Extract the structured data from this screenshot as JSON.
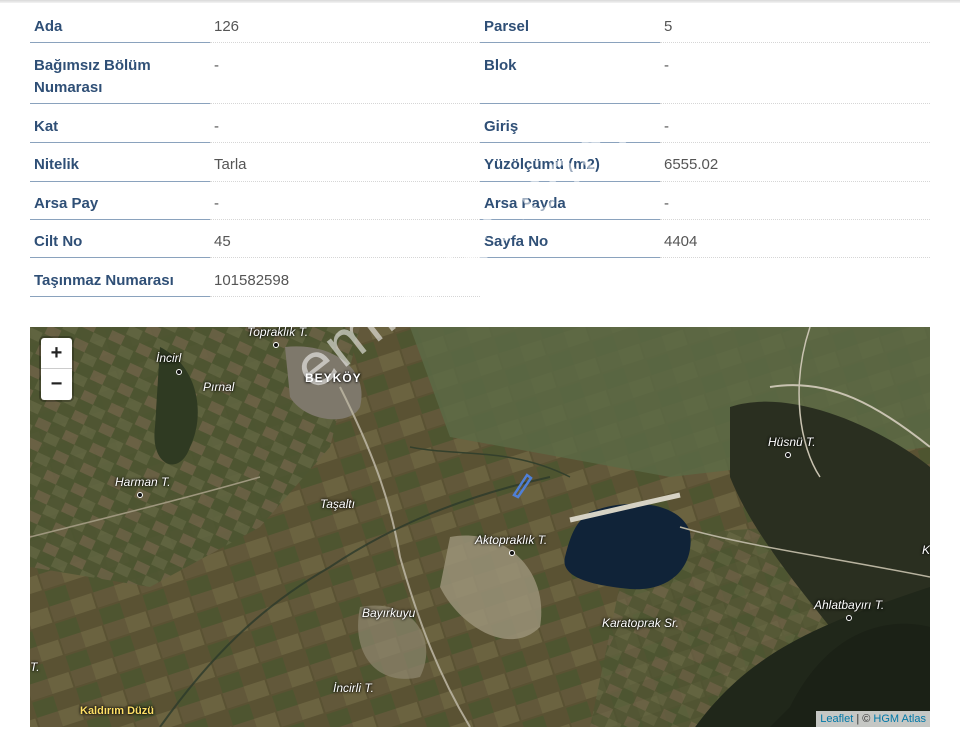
{
  "table": {
    "rows": [
      {
        "left": {
          "label": "Ada",
          "value": "126"
        },
        "right": {
          "label": "Parsel",
          "value": "5"
        }
      },
      {
        "left": {
          "label": "Bağımsız Bölüm Numarası",
          "value": "-"
        },
        "right": {
          "label": "Blok",
          "value": "-"
        }
      },
      {
        "left": {
          "label": "Kat",
          "value": "-"
        },
        "right": {
          "label": "Giriş",
          "value": "-"
        }
      },
      {
        "left": {
          "label": "Nitelik",
          "value": "Tarla"
        },
        "right": {
          "label": "Yüzölçümü (m2)",
          "value": "6555.02"
        }
      },
      {
        "left": {
          "label": "Arsa Pay",
          "value": "-"
        },
        "right": {
          "label": "Arsa Payda",
          "value": "-"
        }
      },
      {
        "left": {
          "label": "Cilt No",
          "value": "45"
        },
        "right": {
          "label": "Sayfa No",
          "value": "4404"
        }
      },
      {
        "left": {
          "label": "Taşınmaz Numarası",
          "value": "101582598"
        }
      }
    ]
  },
  "map": {
    "zoom_in": "+",
    "zoom_out": "−",
    "attribution_leaflet": "Leaflet",
    "attribution_sep": " | © ",
    "attribution_hgm": "HGM Atlas",
    "places": {
      "toprak": "Topraklık T.",
      "incirl": "İncirl",
      "pirnal": "Pırnal",
      "beykoy": "BEYKÖY",
      "harman": "Harman T.",
      "tasalti": "Taşaltı",
      "aktop": "Aktopraklık T.",
      "husnu": "Hüsnü T.",
      "karatoprak": "Karatoprak Sr.",
      "ahlat": "Ahlatbayırı T.",
      "bayirkuyu": "Bayırkuyu",
      "incirli": "İncirli T.",
      "kaldirim": "Kaldırım Düzü",
      "t_edge": "T.",
      "k_edge": "K"
    },
    "colors": {
      "lake": "#102338",
      "parcel": "#4f7fd6"
    }
  },
  "watermark": "emlakjet.com"
}
